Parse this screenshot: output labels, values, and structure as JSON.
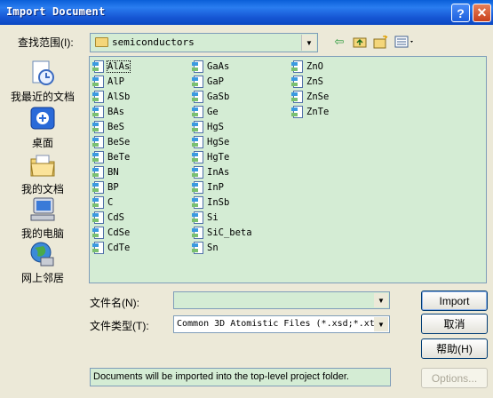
{
  "window": {
    "title": "Import Document",
    "help_glyph": "?",
    "close_glyph": "✕"
  },
  "lookin": {
    "label": "查找范围(I):",
    "folder": "semiconductors"
  },
  "places": [
    {
      "label": "我最近的文档",
      "icon": "recent-documents-icon"
    },
    {
      "label": "桌面",
      "icon": "desktop-icon"
    },
    {
      "label": "我的文档",
      "icon": "my-documents-icon"
    },
    {
      "label": "我的电脑",
      "icon": "my-computer-icon"
    },
    {
      "label": "网上邻居",
      "icon": "network-places-icon"
    }
  ],
  "files": {
    "col1": [
      "AlAs",
      "AlP",
      "AlSb",
      "BAs",
      "BeS",
      "BeSe",
      "BeTe",
      "BN",
      "BP",
      "C",
      "CdS",
      "CdSe",
      "CdTe"
    ],
    "col2": [
      "GaAs",
      "GaP",
      "GaSb",
      "Ge",
      "HgS",
      "HgSe",
      "HgTe",
      "InAs",
      "InP",
      "InSb",
      "Si",
      "SiC_beta",
      "Sn"
    ],
    "col3": [
      "ZnO",
      "ZnS",
      "ZnSe",
      "ZnTe"
    ]
  },
  "filename": {
    "label": "文件名(N):",
    "value": ""
  },
  "filetype": {
    "label": "文件类型(T):",
    "value": "Common 3D Atomistic Files (*.xsd;*.xt"
  },
  "buttons": {
    "import": "Import",
    "cancel": "取消",
    "help": "帮助(H)",
    "options": "Options..."
  },
  "status_text": "Documents will be imported into the top-level project folder.",
  "colors": {
    "list_bg": "#d4ecd4",
    "title_blue": "#0a5fd8"
  }
}
